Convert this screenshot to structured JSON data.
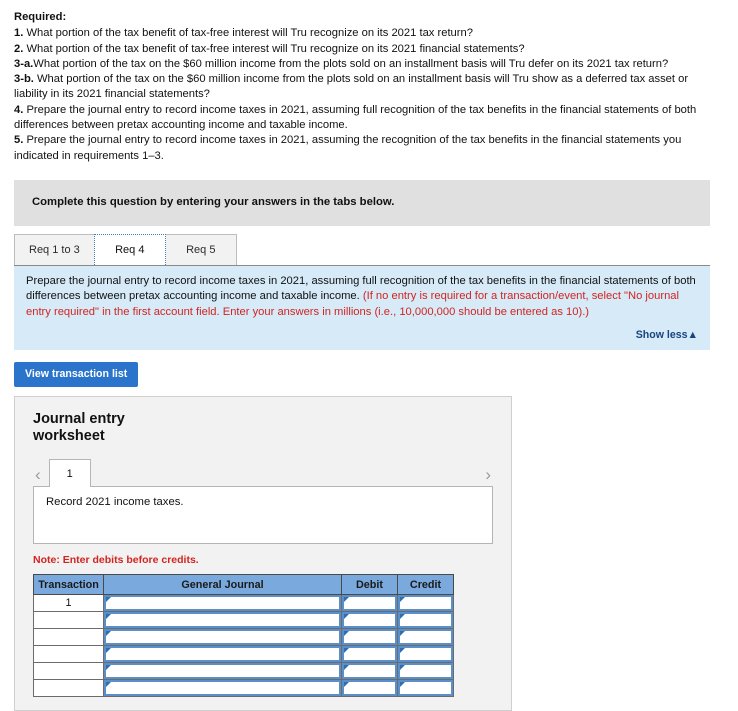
{
  "requirements": {
    "heading": "Required:",
    "items": [
      {
        "num": "1.",
        "text": " What portion of the tax benefit of tax-free interest will Tru recognize on its 2021 tax return?"
      },
      {
        "num": "2.",
        "text": " What portion of the tax benefit of tax-free interest will Tru recognize on its 2021 financial statements?"
      },
      {
        "num": "3-a.",
        "text": "What portion of the tax on the $60 million income from the plots sold on an installment basis will Tru defer on its 2021 tax return?"
      },
      {
        "num": "3-b.",
        "text": " What portion of the tax on the $60 million income from the plots sold on an installment basis will Tru show as a deferred tax asset or liability in its 2021 financial statements?"
      },
      {
        "num": "4.",
        "text": " Prepare the journal entry to record income taxes in 2021, assuming full recognition of the tax benefits in the financial statements of both differences between pretax accounting income and taxable income."
      },
      {
        "num": "5.",
        "text": " Prepare the journal entry to record income taxes in 2021, assuming the recognition of the tax benefits in the financial statements you indicated in requirements 1–3."
      }
    ]
  },
  "complete_bar": {
    "text": "Complete this question by entering your answers in the tabs below."
  },
  "tabs": [
    {
      "label": "Req 1 to 3",
      "active": false
    },
    {
      "label": "Req 4",
      "active": true
    },
    {
      "label": "Req 5",
      "active": false
    }
  ],
  "instruction_panel": {
    "black_text_1": "Prepare the journal entry to record income taxes in 2021, assuming full recognition of the tax benefits in the financial statements of both differences between pretax accounting income and taxable income. ",
    "red_text": "(If no entry is required for a transaction/event, select \"No journal entry required\" in the first account field. Enter your answers in millions (i.e., 10,000,000 should be entered as 10).)",
    "show_less_label": "Show less▲",
    "background_color": "#d6eaf8",
    "red_color": "#d3241f"
  },
  "view_transaction_button": {
    "label": "View transaction list",
    "color": "#2b74cc"
  },
  "worksheet": {
    "title": "Journal entry worksheet",
    "prev_icon": "‹",
    "next_icon": "›",
    "page_tabs": [
      {
        "label": "1",
        "active": true
      }
    ],
    "description": "Record 2021 income taxes.",
    "note": "Note: Enter debits before credits.",
    "note_color": "#d3241f"
  },
  "journal_table": {
    "header_color": "#7aa9de",
    "columns": [
      "Transaction",
      "General Journal",
      "Debit",
      "Credit"
    ],
    "rows": [
      {
        "transaction": "1",
        "general_journal": "",
        "debit": "",
        "credit": ""
      },
      {
        "transaction": "",
        "general_journal": "",
        "debit": "",
        "credit": ""
      },
      {
        "transaction": "",
        "general_journal": "",
        "debit": "",
        "credit": ""
      },
      {
        "transaction": "",
        "general_journal": "",
        "debit": "",
        "credit": ""
      },
      {
        "transaction": "",
        "general_journal": "",
        "debit": "",
        "credit": ""
      },
      {
        "transaction": "",
        "general_journal": "",
        "debit": "",
        "credit": ""
      }
    ]
  }
}
